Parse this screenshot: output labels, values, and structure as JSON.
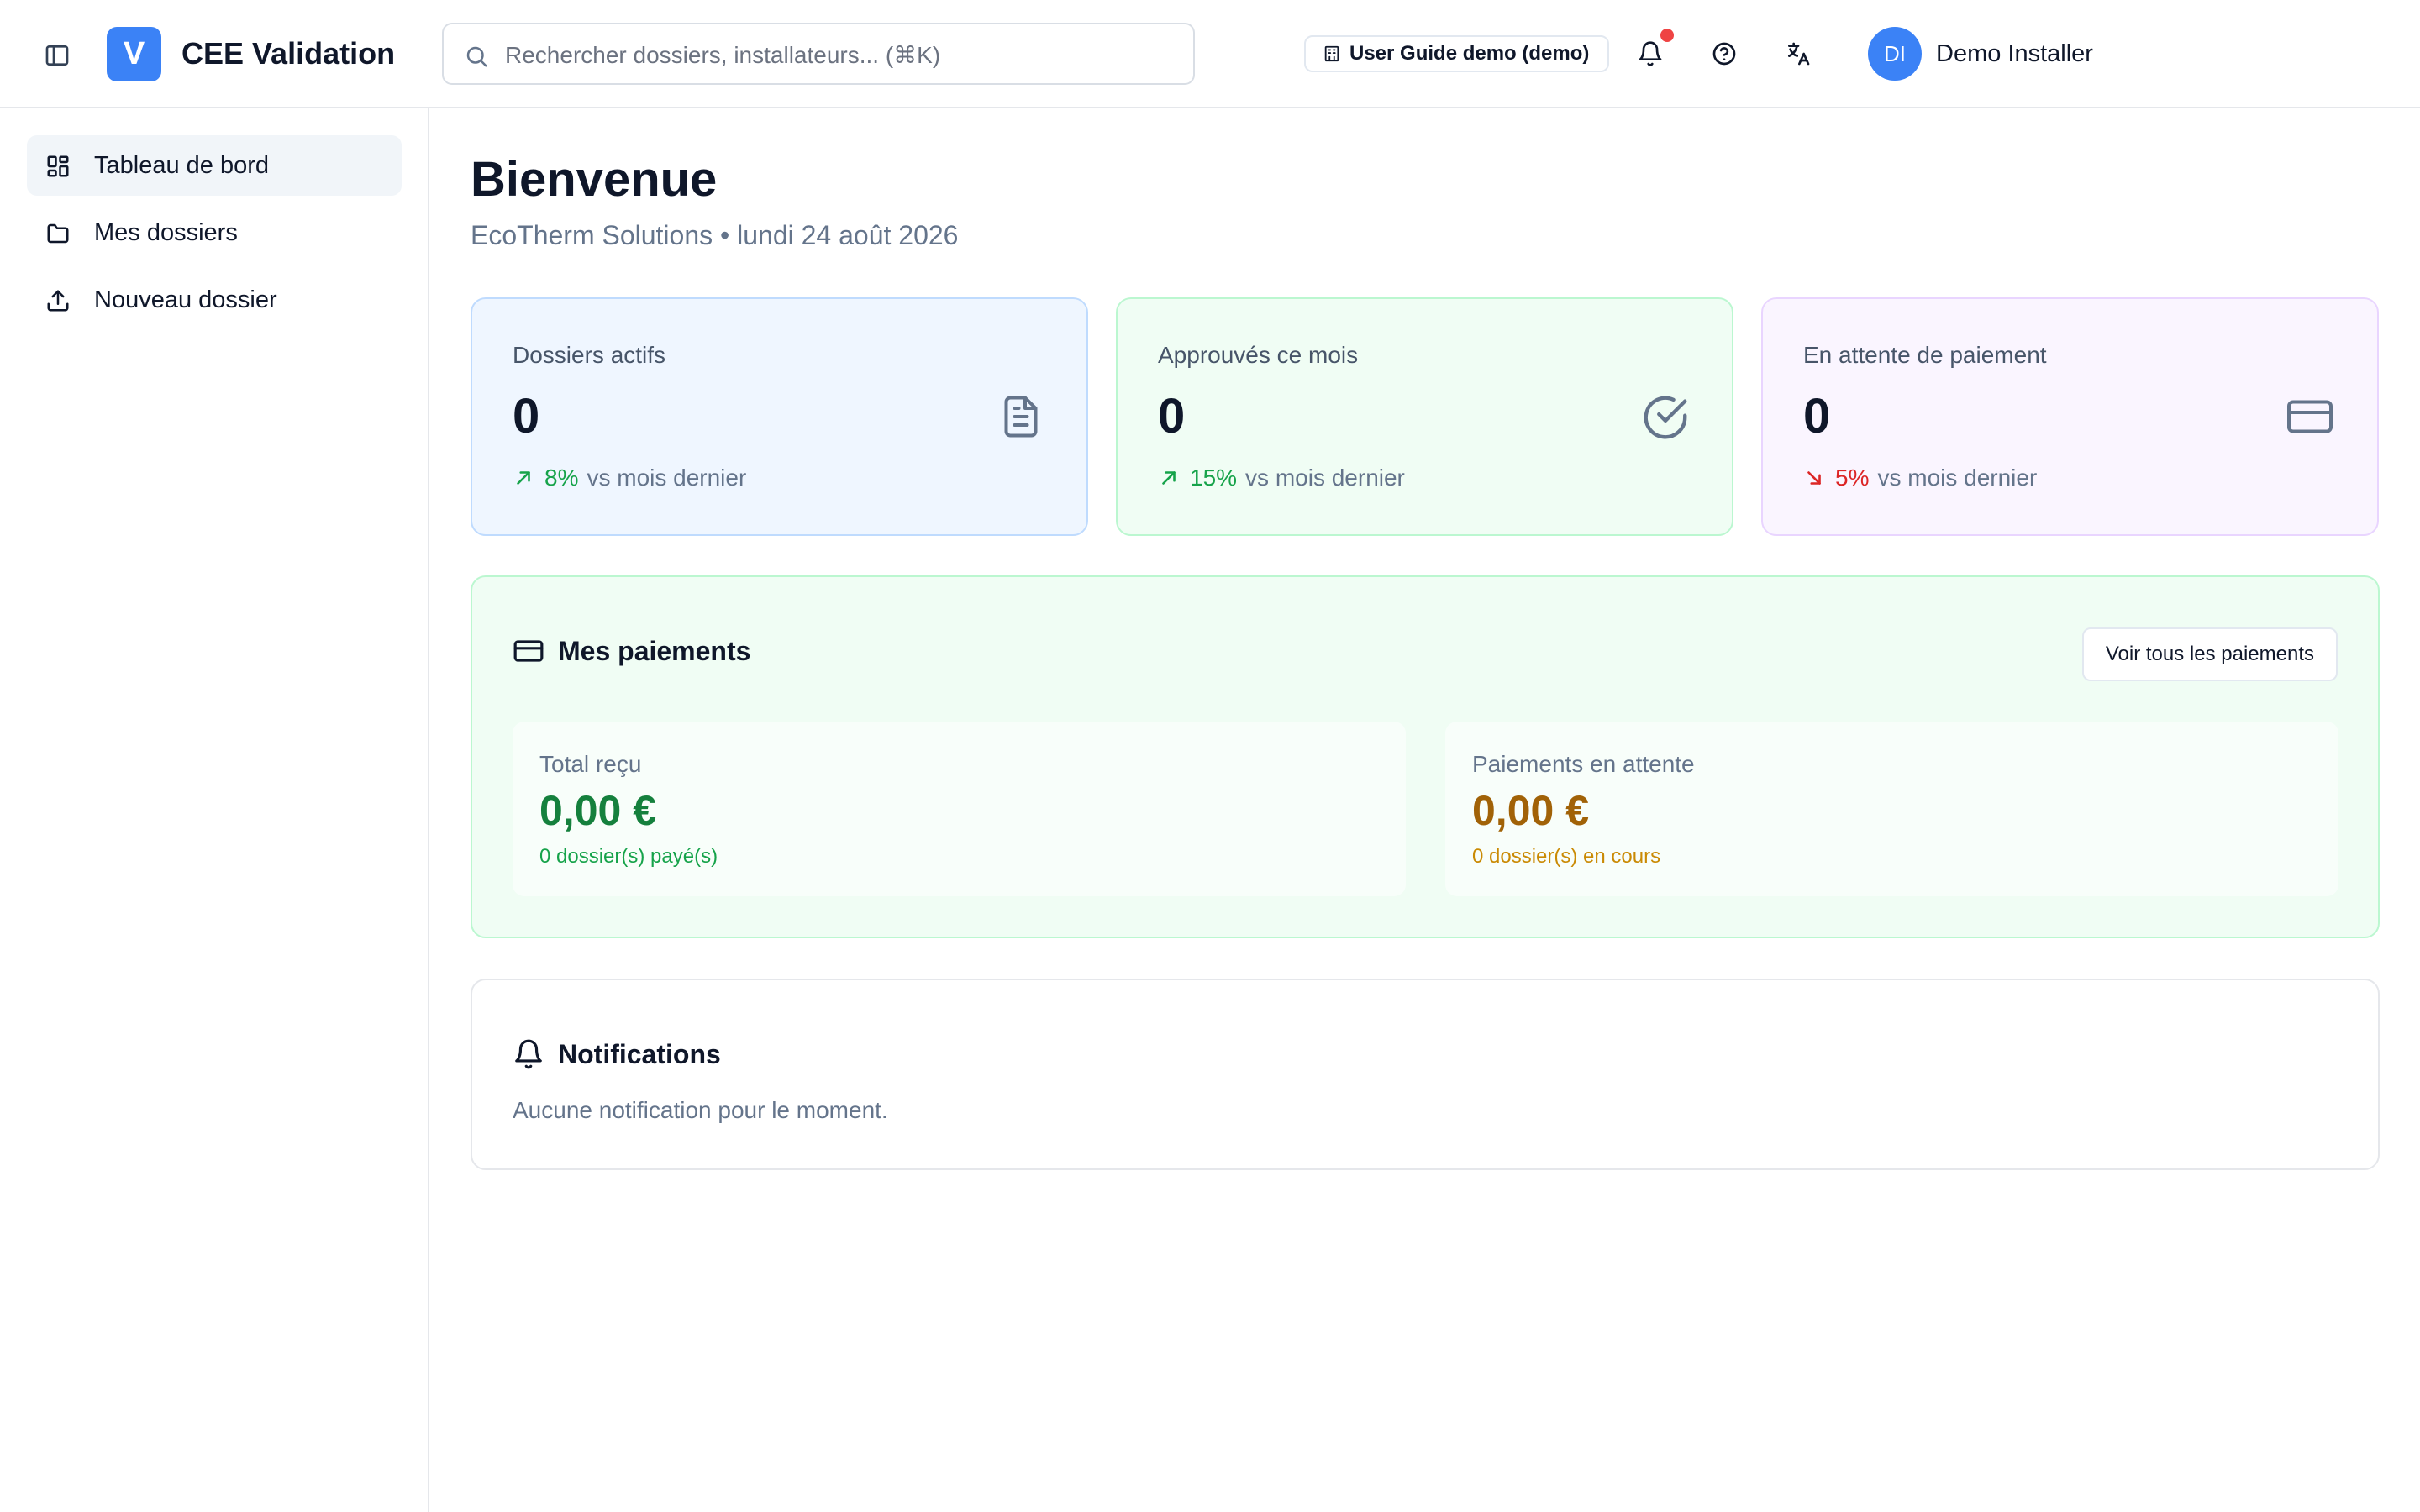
{
  "header": {
    "logo_letter": "V",
    "app_title": "CEE Validation",
    "search_placeholder": "Rechercher dossiers, installateurs... (⌘K)",
    "guide_button": "User Guide demo (demo)",
    "user_initials": "DI",
    "user_name": "Demo Installer",
    "has_unread_notifications": true
  },
  "sidebar": {
    "items": [
      {
        "label": "Tableau de bord",
        "icon": "dashboard-icon",
        "active": true
      },
      {
        "label": "Mes dossiers",
        "icon": "folder-icon",
        "active": false
      },
      {
        "label": "Nouveau dossier",
        "icon": "upload-icon",
        "active": false
      }
    ]
  },
  "main": {
    "title": "Bienvenue",
    "subtitle": "EcoTherm Solutions • lundi 24 août 2026",
    "stats": [
      {
        "label": "Dossiers actifs",
        "value": "0",
        "trend": "8%",
        "trend_direction": "up",
        "trend_suffix": "vs mois dernier",
        "icon": "document-icon",
        "color": "blue"
      },
      {
        "label": "Approuvés ce mois",
        "value": "0",
        "trend": "15%",
        "trend_direction": "up",
        "trend_suffix": "vs mois dernier",
        "icon": "check-circle-icon",
        "color": "green"
      },
      {
        "label": "En attente de paiement",
        "value": "0",
        "trend": "5%",
        "trend_direction": "down",
        "trend_suffix": "vs mois dernier",
        "icon": "credit-card-icon",
        "color": "purple"
      }
    ],
    "payments": {
      "title": "Mes paiements",
      "see_all": "Voir tous les paiements",
      "received": {
        "label": "Total reçu",
        "amount": "0,00 €",
        "sub": "0 dossier(s) payé(s)"
      },
      "pending": {
        "label": "Paiements en attente",
        "amount": "0,00 €",
        "sub": "0 dossier(s) en cours"
      }
    },
    "notifications": {
      "title": "Notifications",
      "empty": "Aucune notification pour le moment."
    }
  },
  "colors": {
    "brand": "#3b82f6",
    "trend_up": "#16a34a",
    "trend_down": "#dc2626",
    "received": "#15803d",
    "pending": "#a16207"
  }
}
